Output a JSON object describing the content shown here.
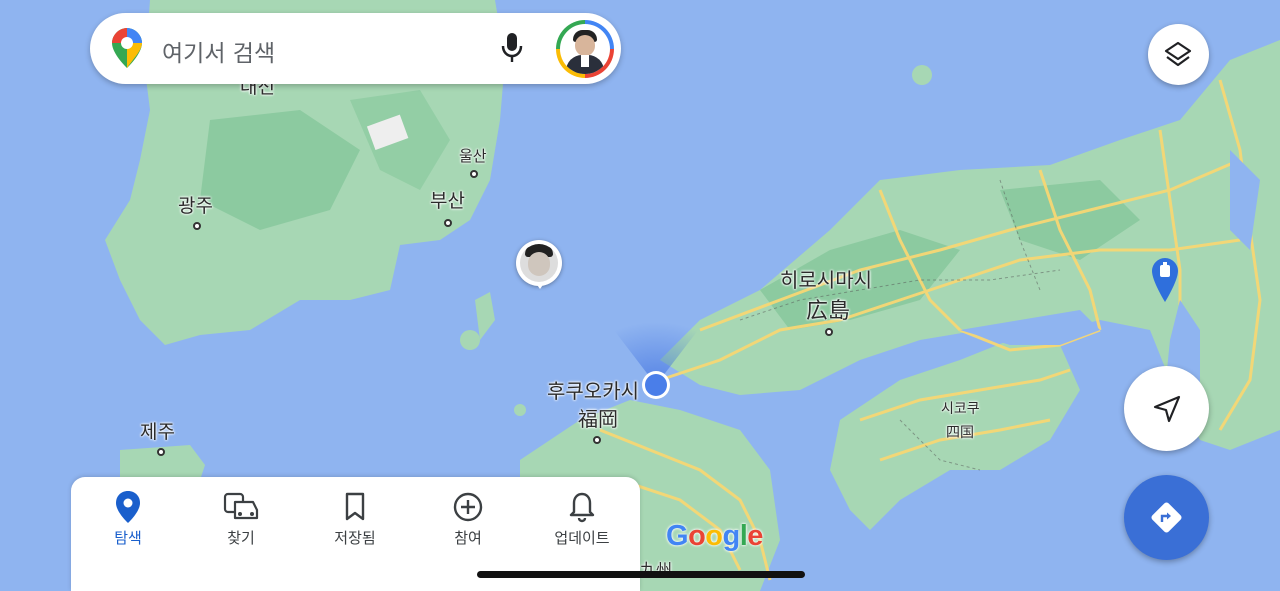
{
  "search": {
    "placeholder": "여기서 검색"
  },
  "map_labels": {
    "daegu_partial": "대전",
    "ulsan": "울산",
    "busan": "부산",
    "gwangju": "광주",
    "jeju": "제주",
    "hiroshima_ko": "히로시마시",
    "hiroshima_ja": "広島",
    "fukuoka_ko": "후쿠오카시",
    "fukuoka_ja": "福岡",
    "shikoku_ko": "시코쿠",
    "shikoku_ja": "四国",
    "kyushu_partial": "九州"
  },
  "google_logo": {
    "G": "G",
    "o1": "o",
    "o2": "o",
    "g": "g",
    "l": "l",
    "e": "e"
  },
  "bottom_nav": {
    "items": [
      {
        "label": "탐색",
        "icon": "location-pin-icon"
      },
      {
        "label": "찾기",
        "icon": "car-transit-icon"
      },
      {
        "label": "저장됨",
        "icon": "bookmark-icon"
      },
      {
        "label": "참여",
        "icon": "add-circle-icon"
      },
      {
        "label": "업데이트",
        "icon": "bell-icon"
      }
    ]
  },
  "colors": {
    "water": "#8fb4f0",
    "land": "#a7d7b4",
    "land_dark": "#7fc197",
    "road": "#f7d774",
    "accent": "#1a5fcc",
    "directions_button": "#3a6fd6"
  }
}
